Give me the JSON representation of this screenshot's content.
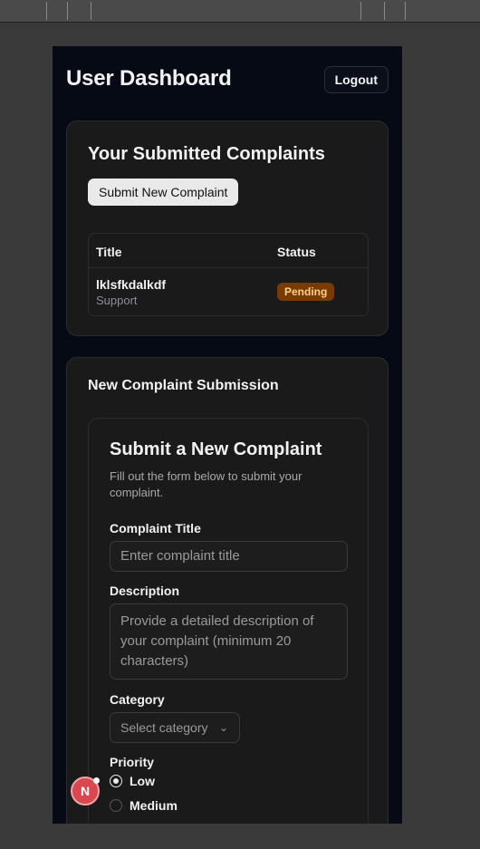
{
  "header": {
    "title": "User Dashboard",
    "logout_label": "Logout"
  },
  "complaints": {
    "title": "Your Submitted Complaints",
    "submit_label": "Submit New Complaint",
    "columns": [
      "Title",
      "Status"
    ],
    "rows": [
      {
        "title": "lklsfkdalkdf",
        "category": "Support",
        "status": "Pending"
      }
    ]
  },
  "submission": {
    "section_title": "New Complaint Submission",
    "form_title": "Submit a New Complaint",
    "form_desc": "Fill out the form below to submit your complaint.",
    "title_label": "Complaint Title",
    "title_placeholder": "Enter complaint title",
    "desc_label": "Description",
    "desc_placeholder": "Provide a detailed description of your complaint (minimum 20 characters)",
    "category_label": "Category",
    "category_placeholder": "Select category",
    "priority_label": "Priority",
    "priorities": [
      "Low",
      "Medium"
    ],
    "selected_priority": "Low"
  },
  "dev_badge": {
    "letter": "N"
  },
  "colors": {
    "badge_pending_bg": "#7a3b00",
    "badge_pending_text": "#ffd08a",
    "dev_badge": "#d9474f"
  }
}
